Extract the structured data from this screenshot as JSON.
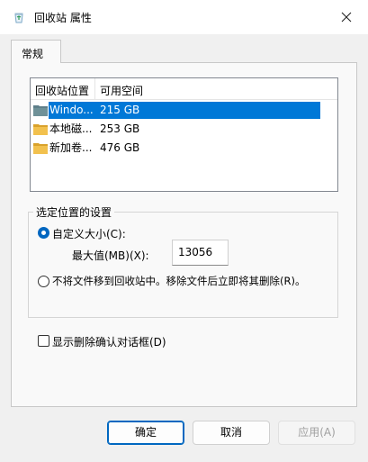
{
  "window": {
    "title": "回收站 属性",
    "icon": "recycle-bin-icon",
    "close_icon": "close-icon"
  },
  "tabs": [
    {
      "label": "常规",
      "selected": true
    }
  ],
  "locations": {
    "headers": [
      "回收站位置",
      "可用空间"
    ],
    "rows": [
      {
        "name": "Windo...",
        "size": "215 GB",
        "icon": "drive-icon",
        "selected": true
      },
      {
        "name": "本地磁...",
        "size": "253 GB",
        "icon": "folder-icon",
        "selected": false
      },
      {
        "name": "新加卷...",
        "size": "476 GB",
        "icon": "folder-icon",
        "selected": false
      }
    ]
  },
  "settings": {
    "group_title": "选定位置的设置",
    "custom_size_label": "自定义大小(C):",
    "custom_size_checked": true,
    "max_label": "最大值(MB)(X):",
    "max_value": "13056",
    "no_move_label": "不将文件移到回收站中。移除文件后立即将其删除(R)。",
    "no_move_checked": false
  },
  "confirm_dialog": {
    "label": "显示删除确认对话框(D)",
    "checked": false
  },
  "buttons": {
    "ok": "确定",
    "cancel": "取消",
    "apply": "应用(A)"
  },
  "colors": {
    "accent": "#0067c0",
    "selection": "#0078d7",
    "drive_folder": "#e8b43a"
  }
}
